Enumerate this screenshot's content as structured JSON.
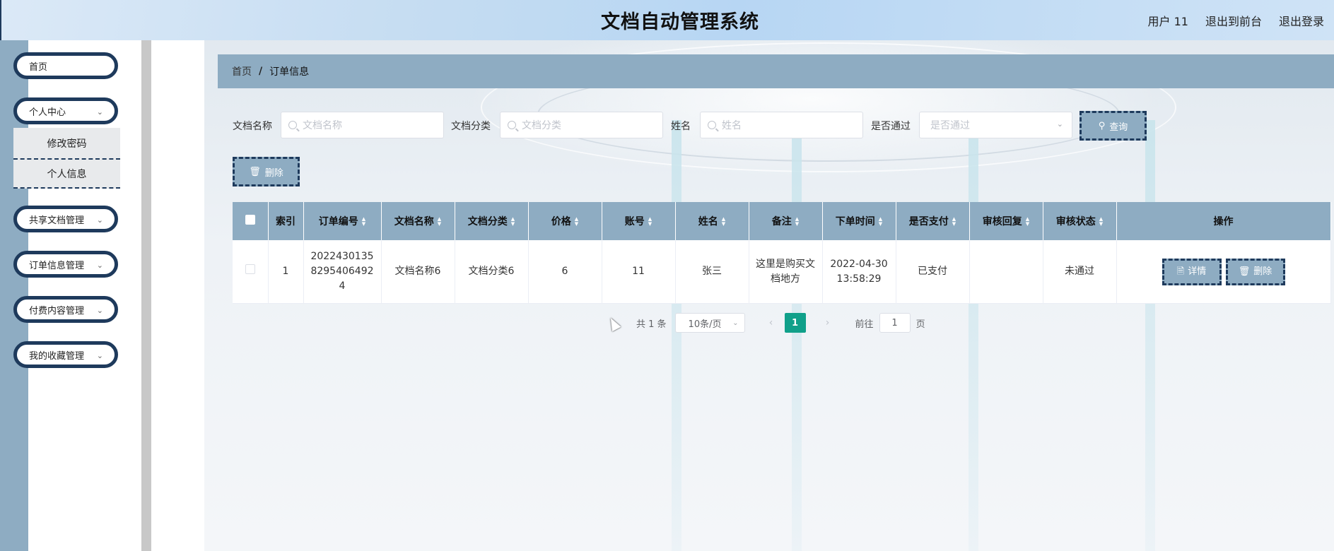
{
  "header": {
    "title": "文档自动管理系统",
    "user": "用户 11",
    "to_front": "退出到前台",
    "logout": "退出登录"
  },
  "sidebar": {
    "home": "首页",
    "personal_center": "个人中心",
    "sub_change_password": "修改密码",
    "sub_personal_info": "个人信息",
    "shared_docs": "共享文档管理",
    "orders": "订单信息管理",
    "paid_content": "付费内容管理",
    "favorites": "我的收藏管理"
  },
  "breadcrumb": {
    "home": "首页",
    "separator": "/",
    "current": "订单信息"
  },
  "search": {
    "doc_name_label": "文档名称",
    "doc_name_placeholder": "文档名称",
    "doc_category_label": "文档分类",
    "doc_category_placeholder": "文档分类",
    "name_label": "姓名",
    "name_placeholder": "姓名",
    "passed_label": "是否通过",
    "passed_placeholder": "是否通过",
    "query_button": "查询"
  },
  "toolbar": {
    "delete_button": "删除"
  },
  "table": {
    "columns": [
      "索引",
      "订单编号",
      "文档名称",
      "文档分类",
      "价格",
      "账号",
      "姓名",
      "备注",
      "下单时间",
      "是否支付",
      "审核回复",
      "审核状态",
      "操作"
    ],
    "rows": [
      {
        "index": "1",
        "order_no": "2022430135 8295406492 4",
        "doc_name": "文档名称6",
        "doc_category": "文档分类6",
        "price": "6",
        "account": "11",
        "name": "张三",
        "remark": "这里是购买文档地方",
        "order_time": "2022-04-30 13:58:29",
        "paid": "已支付",
        "review_reply": "",
        "review_status": "未通过",
        "detail_button": "详情",
        "delete_button": "删除"
      }
    ]
  },
  "pagination": {
    "total": "共 1 条",
    "page_size": "10条/页",
    "current_page": "1",
    "goto_label": "前往",
    "goto_value": "1",
    "page_suffix": "页"
  },
  "colors": {
    "accent": "#8eacc2",
    "border_dark": "#1e3a5c",
    "active_page": "#10a08a"
  }
}
